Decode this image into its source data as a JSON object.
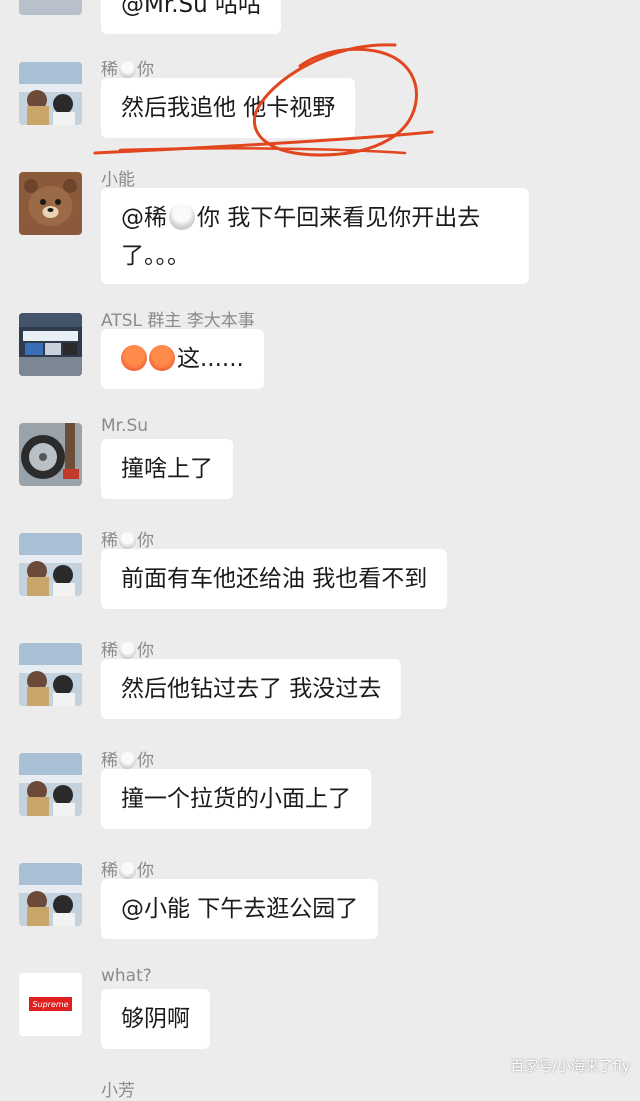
{
  "chat": {
    "partial_top": {
      "text": "@Mr.Su 咕咕"
    },
    "messages": [
      {
        "sender": "稀",
        "sender_suffix": "你",
        "text": "然后我追他 他卡视野"
      },
      {
        "sender": "小能",
        "text_pre": "@稀",
        "text_post": "你 我下午回来看见你开出去了。。。"
      },
      {
        "sender": "ATSL 群主  李大本事",
        "text": "这......"
      },
      {
        "sender": "Mr.Su",
        "text": "撞啥上了"
      },
      {
        "sender": "稀",
        "sender_suffix": "你",
        "text": "前面有车他还给油 我也看不到"
      },
      {
        "sender": "稀",
        "sender_suffix": "你",
        "text": "然后他钻过去了 我没过去"
      },
      {
        "sender": "稀",
        "sender_suffix": "你",
        "text": "撞一个拉货的小面上了"
      },
      {
        "sender": "稀",
        "sender_suffix": "你",
        "text": "@小能 下午去逛公园了"
      },
      {
        "sender": "what?",
        "text": "够阴啊",
        "avatar_text": "Supreme"
      }
    ],
    "bottom_partial_sender": "小芳"
  },
  "watermark": "百家号/小海来了fly",
  "colors": {
    "annotation_red": "#e2461f",
    "bubble": "#ffffff",
    "background": "#ececec"
  }
}
